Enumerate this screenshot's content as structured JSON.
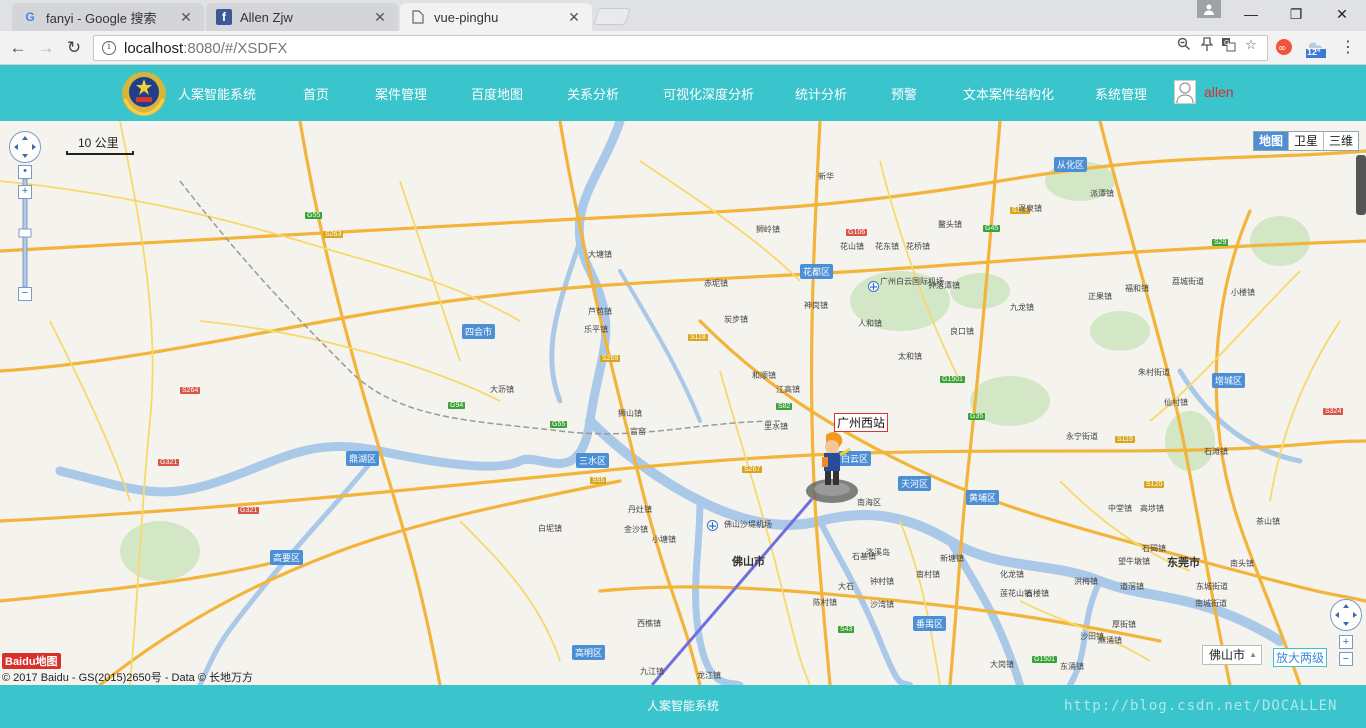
{
  "browser": {
    "tabs": [
      {
        "title": "fanyi - Google 搜索",
        "favicon": "G"
      },
      {
        "title": "Allen Zjw",
        "favicon": "f"
      },
      {
        "title": "vue-pinghu",
        "favicon": "doc"
      }
    ],
    "url_host": "localhost",
    "url_rest": ":8080/#/XSDFX",
    "weather_badge": "12°"
  },
  "header": {
    "app_title": "人案智能系统",
    "nav": [
      "首页",
      "案件管理",
      "百度地图",
      "关系分析",
      "可视化深度分析",
      "统计分析",
      "预警",
      "文本案件结构化",
      "系统管理"
    ],
    "username": "allen"
  },
  "map": {
    "type_buttons": [
      "地图",
      "卫星",
      "三维"
    ],
    "active_type": "地图",
    "scale_label": "10 公里",
    "marker_label": "广州西站",
    "city_select": "佛山市",
    "zoom_two_label": "放大两级",
    "baidu_logo": "Baidu地图",
    "copyright": "© 2017 Baidu - GS(2015)2650号 - Data © 长地万方",
    "cities": [
      {
        "name": "佛山市"
      },
      {
        "name": "东莞市"
      }
    ],
    "districts": [
      "花都区",
      "从化区",
      "四会市",
      "三水区",
      "鼎湖区",
      "白云区",
      "天河区",
      "黄埔区",
      "增城区",
      "高要区",
      "高明区",
      "番禺区"
    ],
    "labels": [
      "广州白云国际机场",
      "佛山沙堤机场",
      "钟落潭镇",
      "太和镇",
      "人和镇",
      "新华",
      "狮岭镇",
      "花东镇",
      "九龙镇",
      "大沥镇",
      "里水镇",
      "和顺镇",
      "南海区",
      "白坭镇",
      "丹灶镇",
      "西樵镇",
      "九江镇",
      "龙江镇",
      "陈村镇",
      "石楼镇",
      "中堂镇",
      "石碣镇",
      "新塘镇",
      "永宁街道",
      "荔城街道",
      "朱村街道",
      "仙村镇",
      "石滩镇",
      "高埗镇",
      "茶山镇",
      "东城街道",
      "南城街道",
      "洪梅镇",
      "厚街镇",
      "沙田镇",
      "道滘镇",
      "江高镇",
      "钟村镇",
      "南村镇",
      "化龙镇",
      "莲花山镇",
      "石基镇",
      "大岗镇",
      "东涌镇",
      "狮山镇",
      "官窑",
      "小塘镇",
      "金沙镇",
      "乐平镇",
      "芦苞镇",
      "大塘镇",
      "炭步镇",
      "赤坭镇",
      "花山镇",
      "花桥镇",
      "神岗镇",
      "良口镇",
      "鳌头镇",
      "温泉镇",
      "派潭镇",
      "正果镇",
      "小楼镇",
      "福和镇",
      "麻涌镇",
      "望牛墩镇",
      "沙湾镇",
      "大石",
      "洛溪岛",
      "南头镇"
    ]
  },
  "footer": {
    "text": "人案智能系统",
    "watermark": "http://blog.csdn.net/DOCALLEN"
  }
}
